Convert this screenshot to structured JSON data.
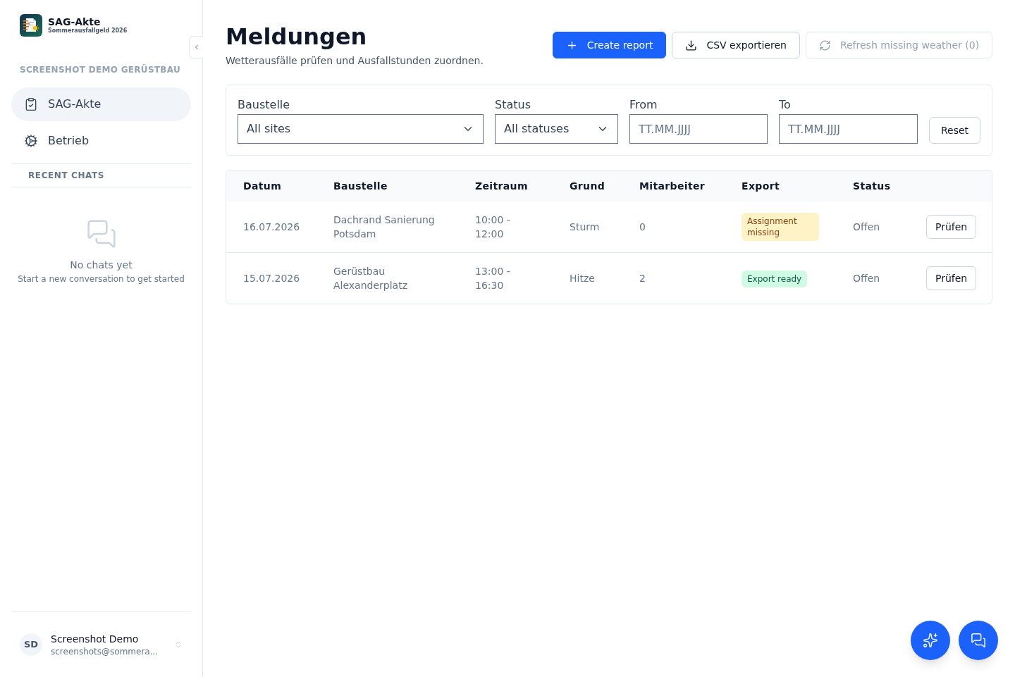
{
  "sidebar": {
    "app": {
      "title": "SAG-Akte",
      "subtitle": "Sommerausfallgeld 2026"
    },
    "section_title": "SCREENSHOT DEMO GERÜSTBAU",
    "nav_items": [
      {
        "label": "SAG-Akte",
        "selected": true
      },
      {
        "label": "Betrieb",
        "selected": false
      }
    ],
    "recent_chats": {
      "title": "RECENT CHATS",
      "empty_title": "No chats yet",
      "empty_hint": "Start a new conversation to get started"
    },
    "user": {
      "initials": "SD",
      "name": "Screenshot Demo",
      "email": "screenshots@sommera..."
    }
  },
  "page": {
    "title": "Meldungen",
    "subtitle": "Wetterausfälle prüfen und Ausfallstunden zuordnen."
  },
  "actions": [
    {
      "label": "Create report",
      "kind": "primary",
      "disabled": false
    },
    {
      "label": "CSV exportieren",
      "kind": "outline",
      "disabled": false
    },
    {
      "label": "Refresh missing weather (0)",
      "kind": "outline",
      "disabled": true
    }
  ],
  "filters": {
    "fields": [
      {
        "label": "Baustelle",
        "kind": "select",
        "value": "All sites"
      },
      {
        "label": "Status",
        "kind": "select",
        "value": "All statuses"
      },
      {
        "label": "From",
        "kind": "date",
        "placeholder": "TT.MM.JJJJ"
      },
      {
        "label": "To",
        "kind": "date",
        "placeholder": "TT.MM.JJJJ"
      }
    ],
    "reset": "Reset"
  },
  "table": {
    "columns": [
      "Datum",
      "Baustelle",
      "Zeitraum",
      "Grund",
      "Mitarbeiter",
      "Export",
      "Status"
    ],
    "rows": [
      {
        "datum": "16.07.2026",
        "baustelle": "Dachrand Sanierung Potsdam",
        "zeitraum": "10:00 - 12:00",
        "grund": "Sturm",
        "mitarbeiter": "0",
        "export": {
          "label": "Assignment missing",
          "kind": "warning"
        },
        "status": "Offen",
        "action": "Prüfen"
      },
      {
        "datum": "15.07.2026",
        "baustelle": "Gerüstbau Alexanderplatz",
        "zeitraum": "13:00 - 16:30",
        "grund": "Hitze",
        "mitarbeiter": "2",
        "export": {
          "label": "Export ready",
          "kind": "success"
        },
        "status": "Offen",
        "action": "Prüfen"
      }
    ]
  }
}
